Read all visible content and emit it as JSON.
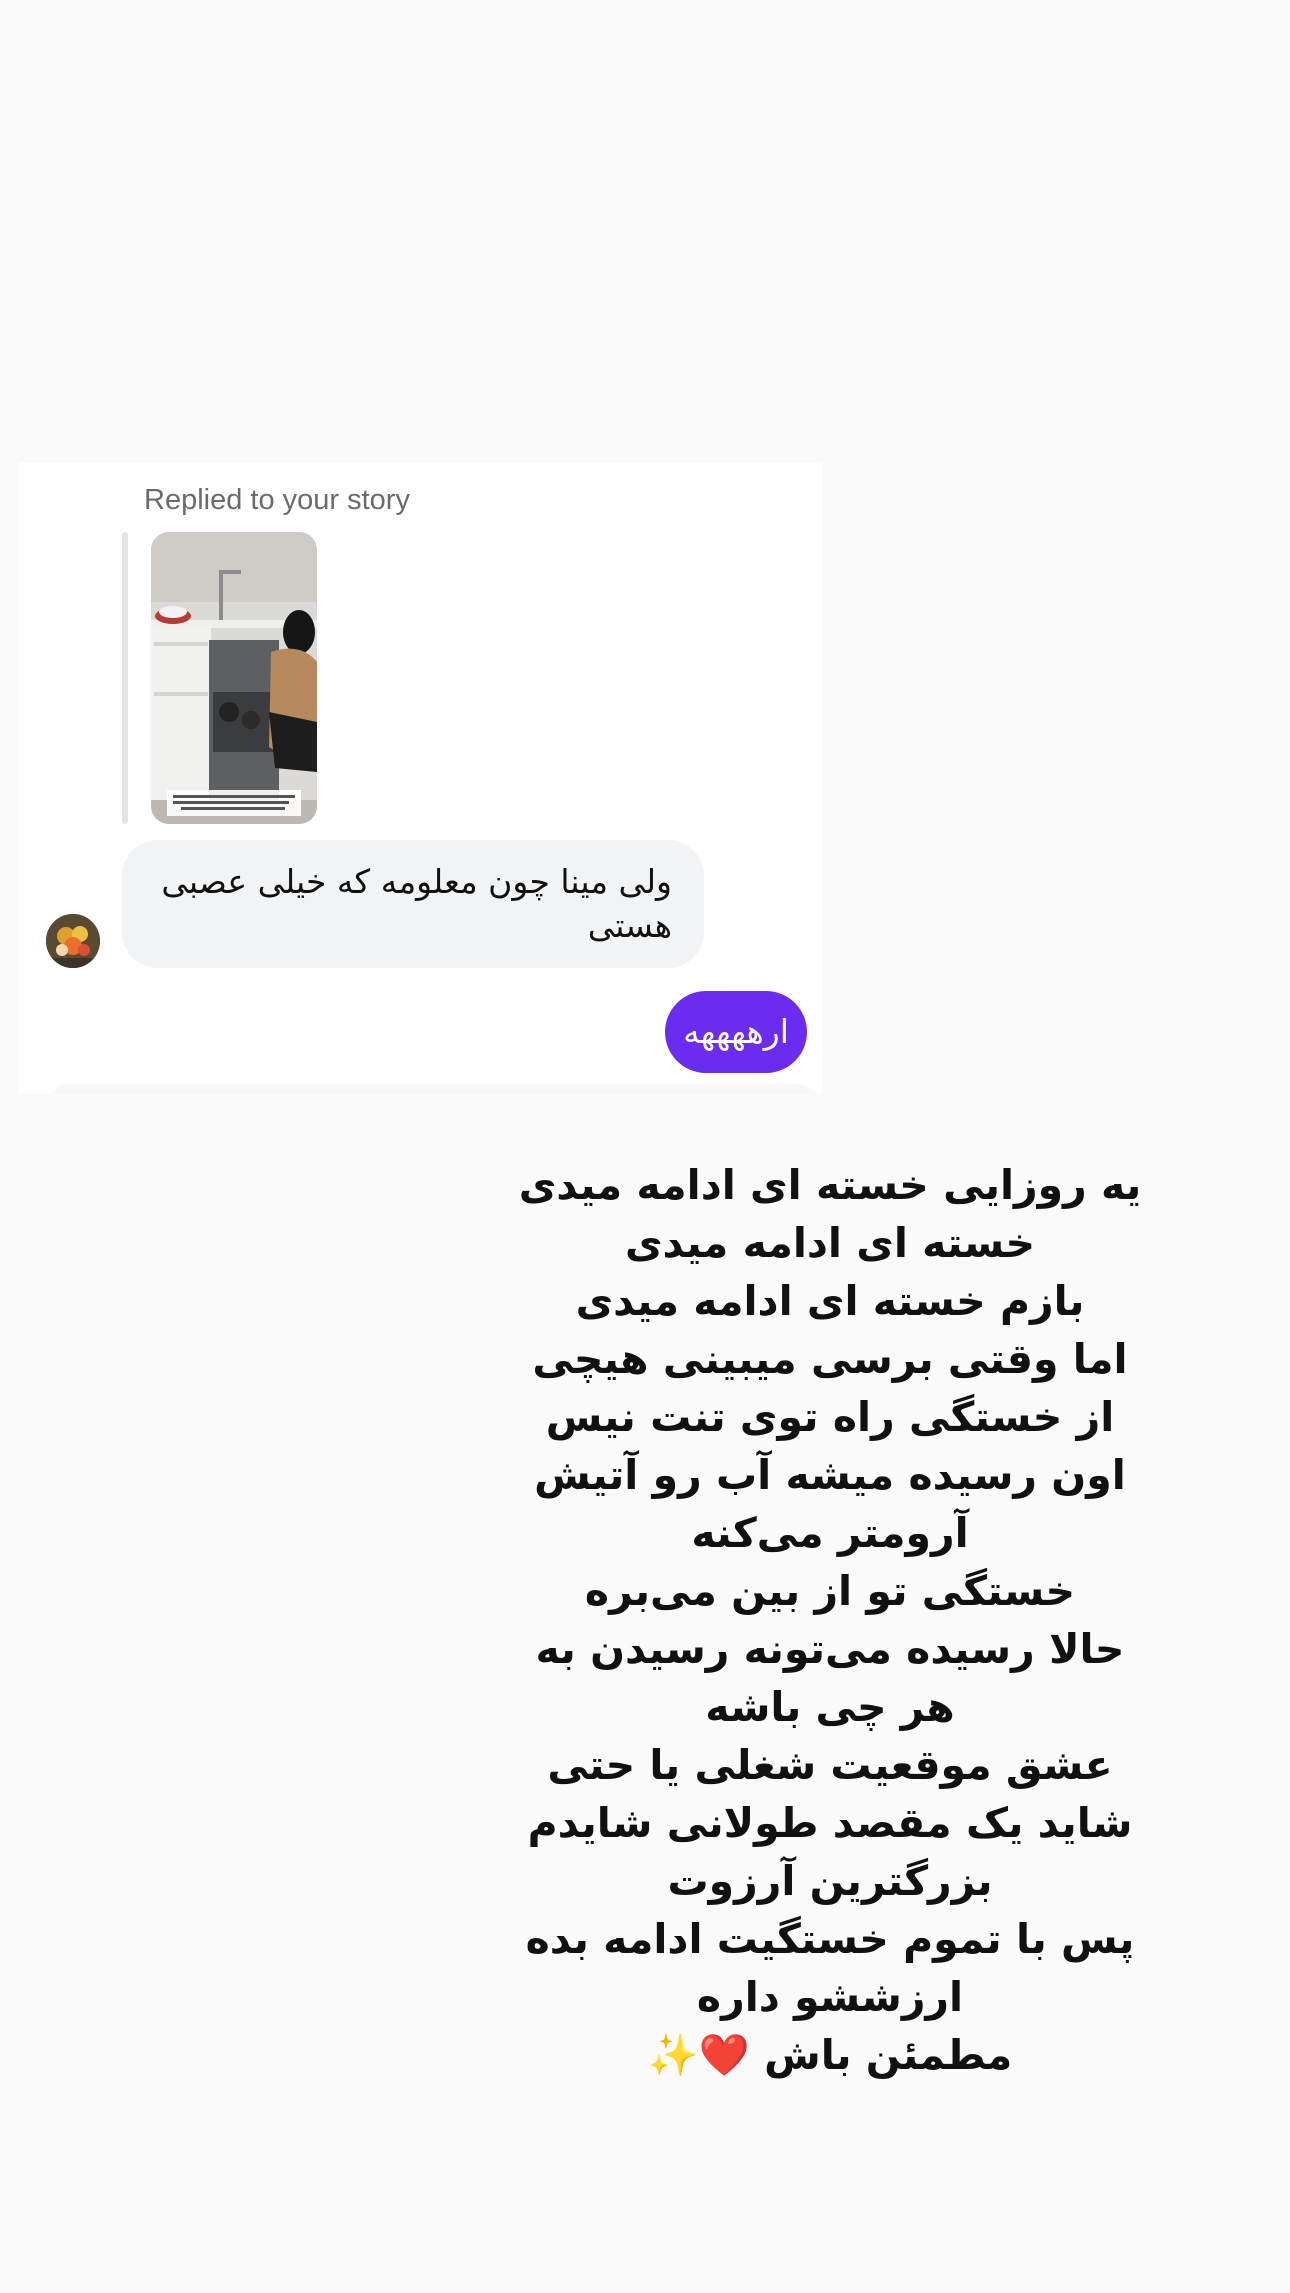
{
  "dm": {
    "replied_label": "Replied to your story",
    "incoming_message": "ولی مینا چون معلومه که خیلی عصبی هستی",
    "outgoing_message": "ارههههه"
  },
  "poem": {
    "lines": [
      "یه روزایی خسته ای ادامه میدی",
      "خسته ای ادامه میدی",
      "بازم خسته ای ادامه میدی",
      "اما وقتی برسی میبینی هیچی",
      "از خستگی راه توی تنت نیس",
      "اون رسیده میشه آب رو آتیش",
      "آرومتر می‌کنه",
      "خستگی تو از بین می‌بره",
      "حالا رسیده می‌تونه رسیدن به",
      "هر چی باشه",
      "عشق موقعیت شغلی یا حتی",
      "شاید یک مقصد طولانی شایدم",
      "بزرگترین آرزوت",
      "پس با تموم خستگیت ادامه بده",
      "ارزششو داره"
    ],
    "last_line_text": "مطمئن باش",
    "last_line_emoji": "❤️✨"
  },
  "colors": {
    "background": "#fafafa",
    "card": "#ffffff",
    "incoming_bubble": "#f2f3f5",
    "outgoing_bubble": "#6c2cf0",
    "heart": "#e0202c"
  }
}
